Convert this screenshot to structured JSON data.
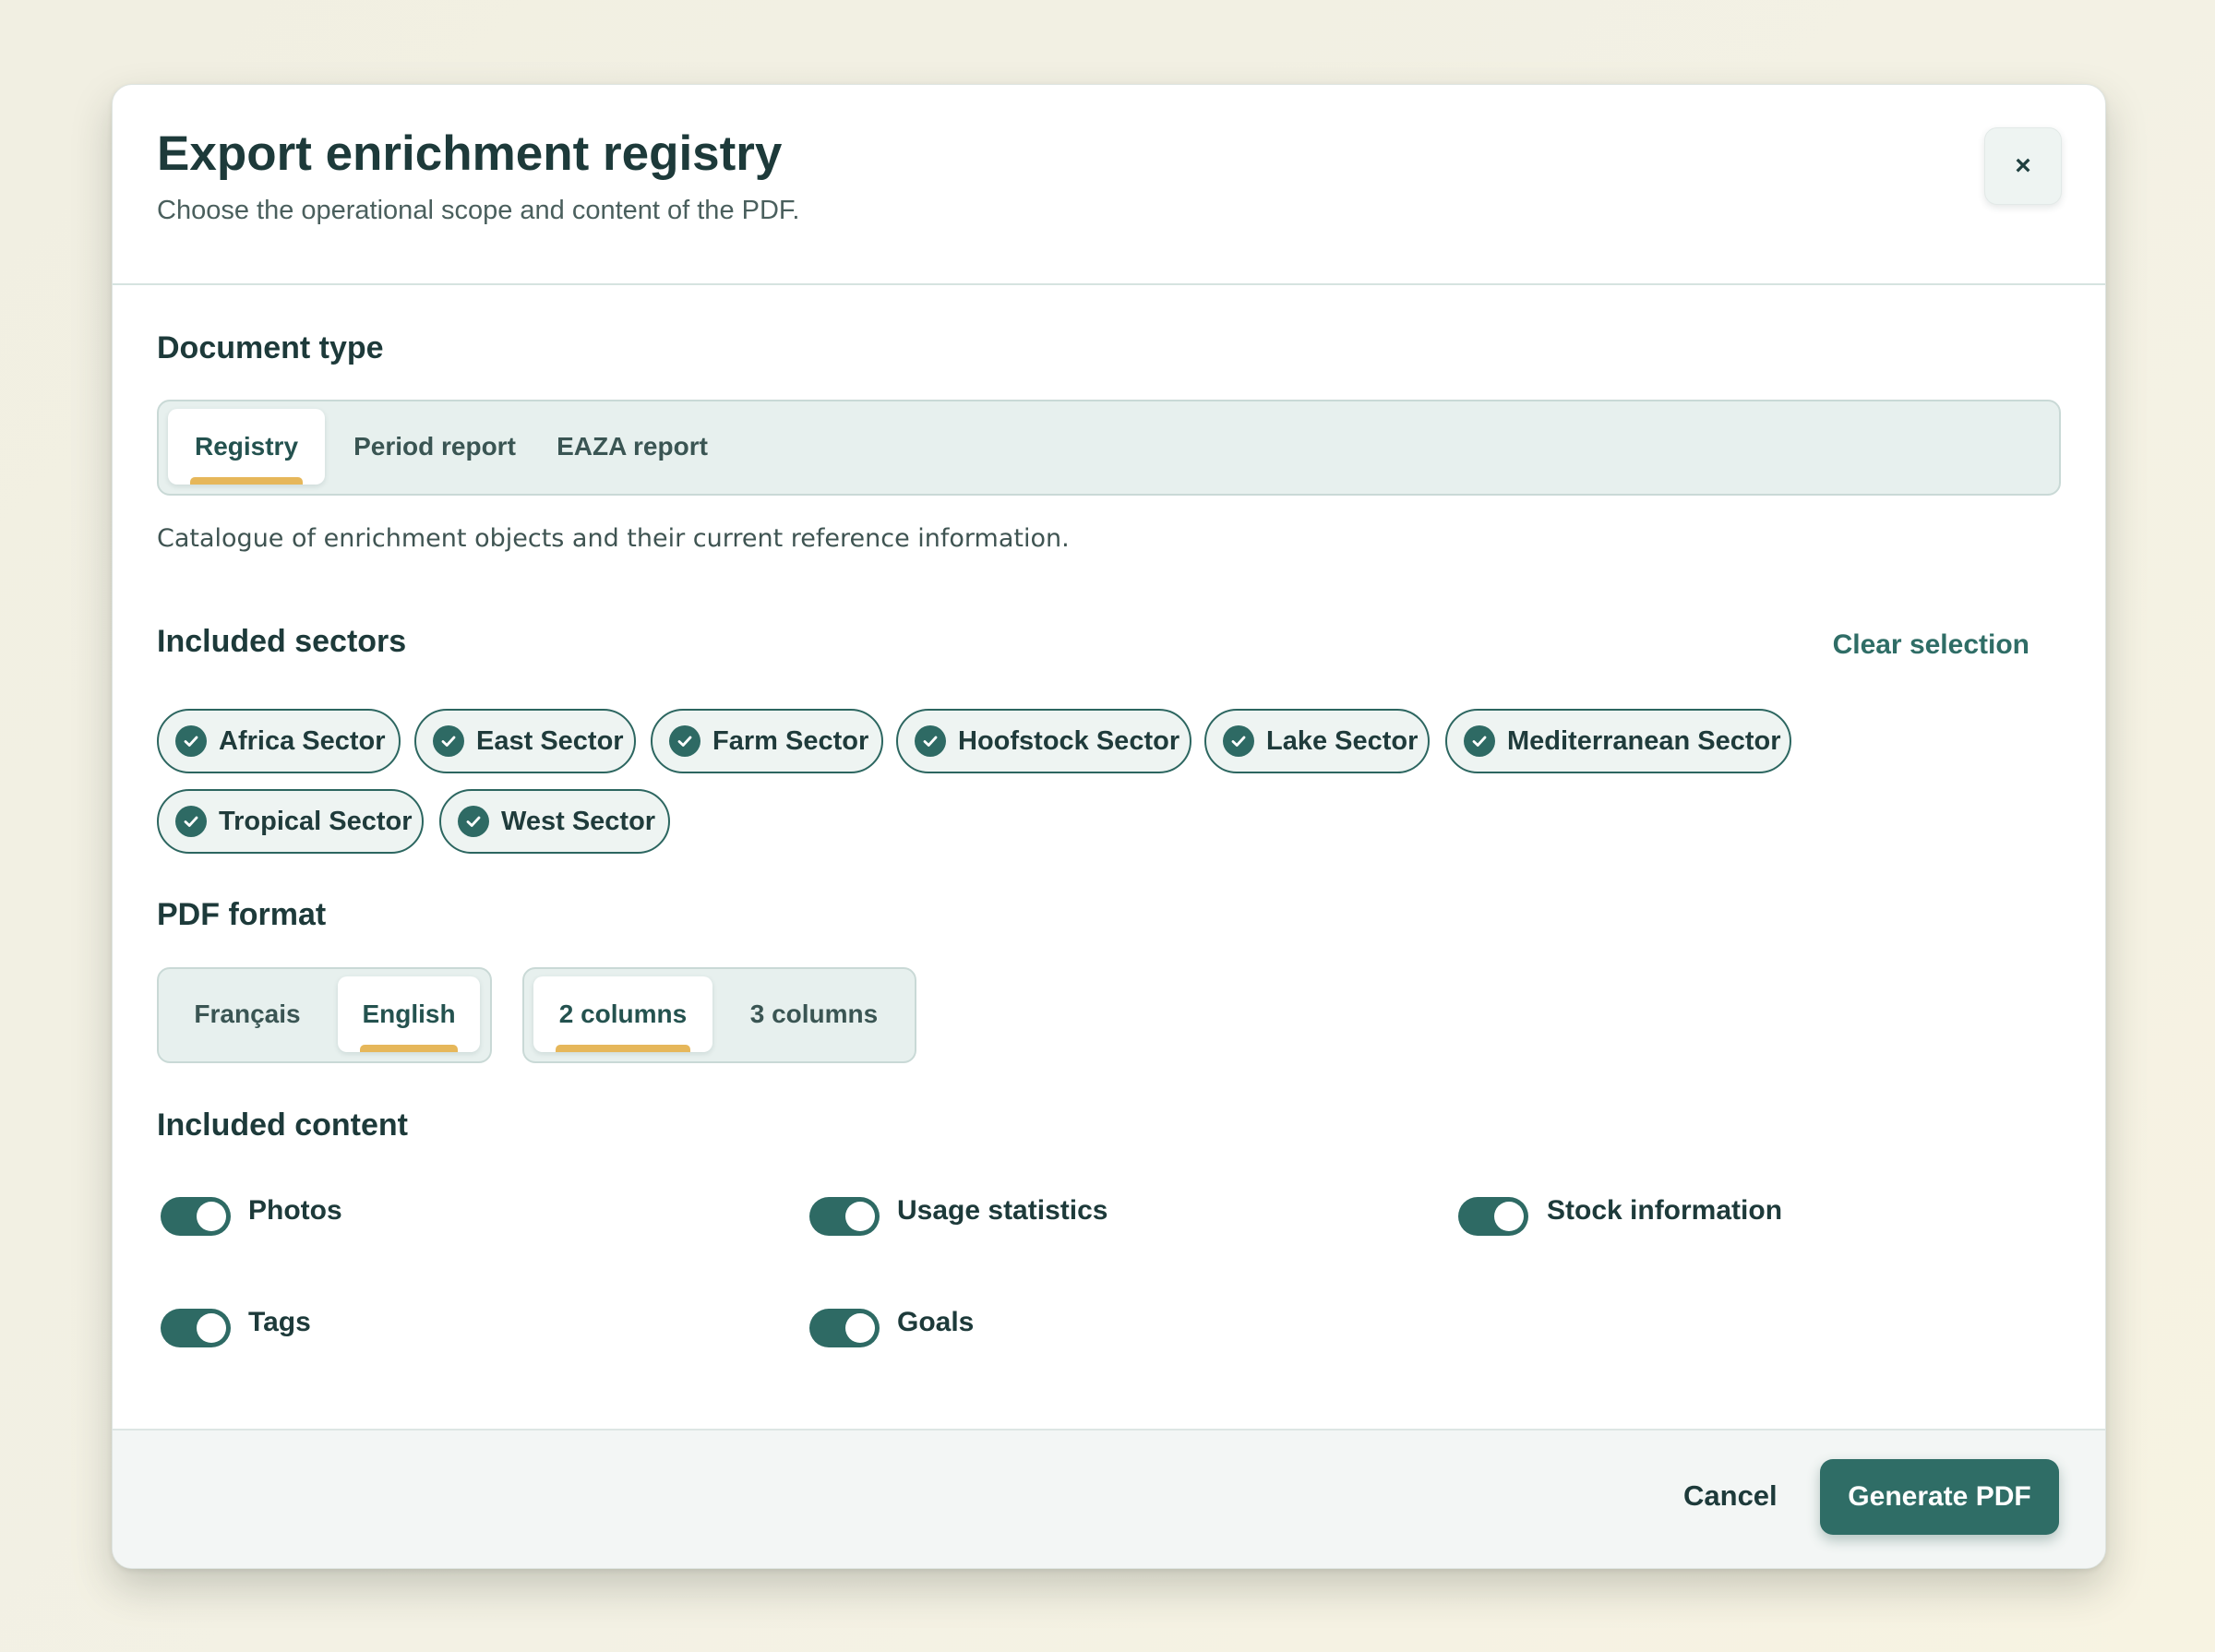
{
  "dialog": {
    "title": "Export enrichment registry",
    "subtitle": "Choose the operational scope and content of the PDF.",
    "close_label": "×"
  },
  "document_type": {
    "label": "Document type",
    "options": [
      "Registry",
      "Period report",
      "EAZA report"
    ],
    "selected": "Registry",
    "description": "Catalogue of enrichment objects and their current reference information."
  },
  "sectors": {
    "label": "Included sectors",
    "clear_label": "Clear selection",
    "items": [
      {
        "label": "Africa Sector",
        "checked": true
      },
      {
        "label": "East Sector",
        "checked": true
      },
      {
        "label": "Farm Sector",
        "checked": true
      },
      {
        "label": "Hoofstock Sector",
        "checked": true
      },
      {
        "label": "Lake Sector",
        "checked": true
      },
      {
        "label": "Mediterranean Sector",
        "checked": true
      },
      {
        "label": "Tropical Sector",
        "checked": true
      },
      {
        "label": "West Sector",
        "checked": true
      }
    ]
  },
  "pdf_format": {
    "label": "PDF format",
    "language": {
      "options": [
        "Français",
        "English"
      ],
      "selected": "English"
    },
    "columns": {
      "options": [
        "2 columns",
        "3 columns"
      ],
      "selected": "2 columns"
    }
  },
  "content": {
    "label": "Included content",
    "items": [
      {
        "label": "Photos",
        "on": true
      },
      {
        "label": "Usage statistics",
        "on": true
      },
      {
        "label": "Stock information",
        "on": true
      },
      {
        "label": "Tags",
        "on": true
      },
      {
        "label": "Goals",
        "on": true
      }
    ]
  },
  "footer": {
    "cancel_label": "Cancel",
    "generate_label": "Generate PDF"
  },
  "colors": {
    "accent": "#2f6d66",
    "highlight": "#e6b75a",
    "text": "#1d3a3a"
  }
}
